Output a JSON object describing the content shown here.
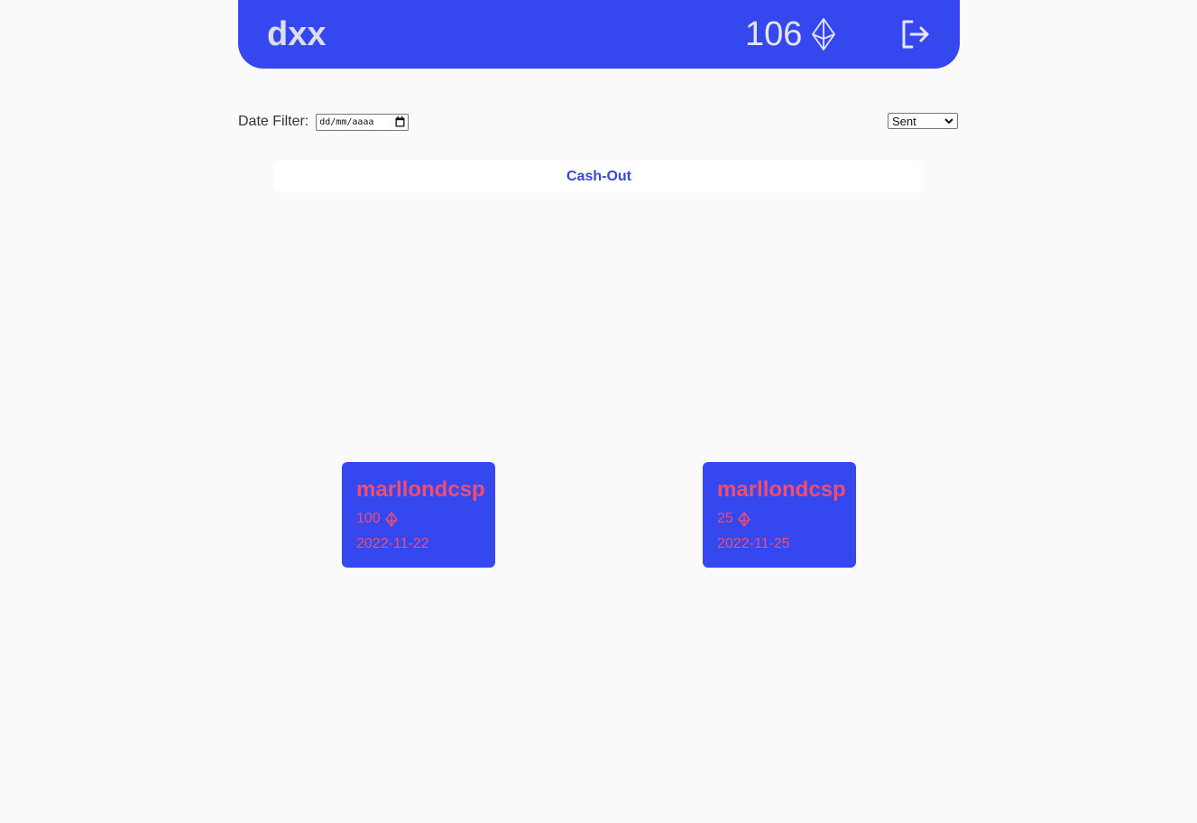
{
  "header": {
    "username": "dxx",
    "balance": "106",
    "balance_icon": "ethereum-icon",
    "logout_icon": "logout-icon"
  },
  "filters": {
    "date_label": "Date Filter:",
    "date_placeholder": "dd/mm/aaaa",
    "type_selected": "Sent"
  },
  "cashout": {
    "label": "Cash-Out"
  },
  "transactions": [
    {
      "name": "marllondcsp",
      "amount": "100",
      "date": "2022-11-22"
    },
    {
      "name": "marllondcsp",
      "amount": "25",
      "date": "2022-11-25"
    }
  ],
  "colors": {
    "accent": "#3548f0",
    "card_text": "#f04e6e",
    "background": "#fafafa"
  }
}
